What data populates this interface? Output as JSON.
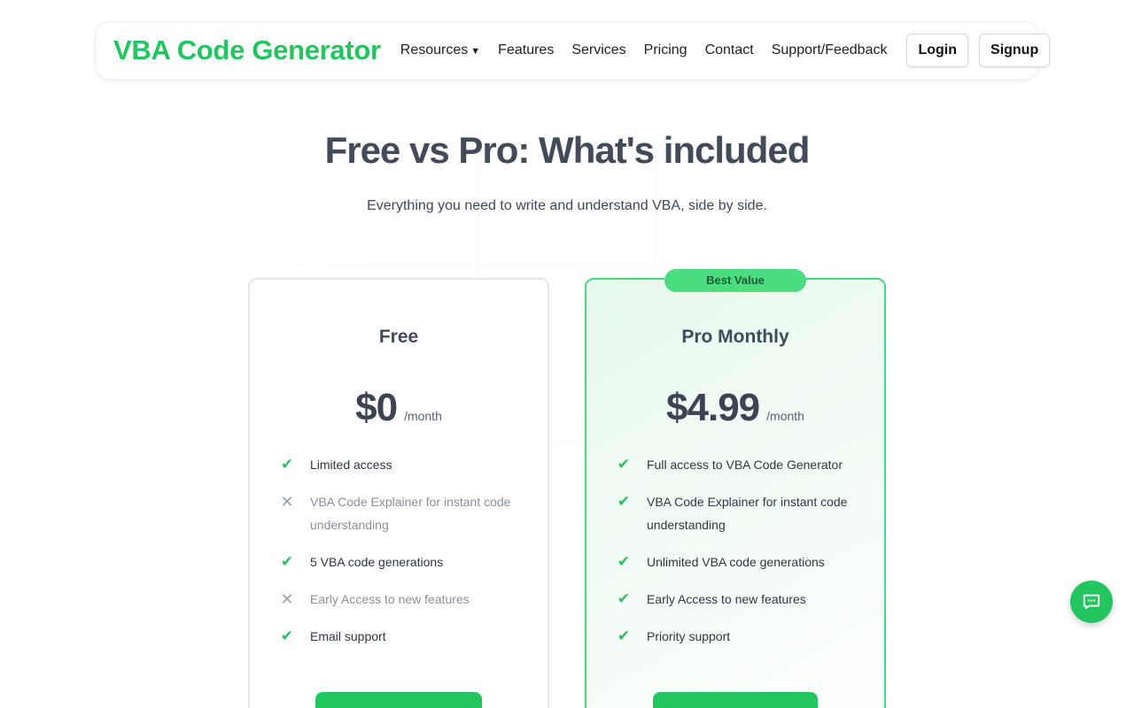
{
  "brand": {
    "name": "VBA Code Generator",
    "color": "#22c55e"
  },
  "nav": {
    "links": [
      {
        "label": "Resources",
        "has_dropdown": true
      },
      {
        "label": "Features"
      },
      {
        "label": "Services"
      },
      {
        "label": "Pricing"
      },
      {
        "label": "Contact"
      },
      {
        "label": "Support/Feedback"
      }
    ],
    "login_label": "Login",
    "signup_label": "Signup"
  },
  "hero": {
    "title": "Free vs Pro: What's included",
    "subtitle": "Everything you need to write and understand VBA, side by side."
  },
  "plans": [
    {
      "name": "Free",
      "price": "$0",
      "period": "/month",
      "features": [
        {
          "text": "Limited access",
          "included": true
        },
        {
          "text": "VBA Code Explainer for instant code understanding",
          "included": false
        },
        {
          "text": "5 VBA code generations",
          "included": true
        },
        {
          "text": "Early Access to new features",
          "included": false
        },
        {
          "text": "Email support",
          "included": true
        }
      ],
      "cta_label": ""
    },
    {
      "name": "Pro Monthly",
      "badge": "Best Value",
      "price": "$4.99",
      "period": "/month",
      "features": [
        {
          "text": "Full access to VBA Code Generator",
          "included": true
        },
        {
          "text": "VBA Code Explainer for instant code understanding",
          "included": true
        },
        {
          "text": "Unlimited VBA code generations",
          "included": true
        },
        {
          "text": "Early Access to new features",
          "included": true
        },
        {
          "text": "Priority support",
          "included": true
        }
      ],
      "cta_label": ""
    }
  ],
  "icons": {
    "check": "check-icon",
    "cross": "cross-icon",
    "chat": "chat-icon"
  },
  "colors": {
    "accent": "#22c55e",
    "badge": "#4ade80",
    "heading": "#434b5a"
  }
}
